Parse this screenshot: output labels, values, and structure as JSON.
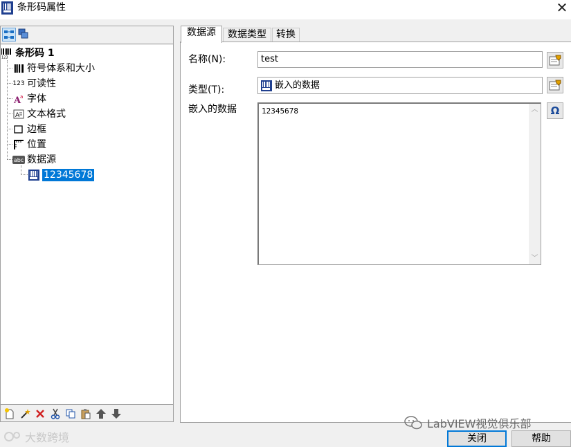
{
  "window": {
    "title": "条形码属性",
    "close_glyph": "✕"
  },
  "left_toolbar": {
    "icons": [
      "tree-view-icon",
      "layers-icon"
    ]
  },
  "tree": {
    "root": {
      "label": "条形码 1",
      "icon": "barcode-small-icon"
    },
    "items": [
      {
        "label": "符号体系和大小",
        "icon": "barcode-icon"
      },
      {
        "label": "可读性",
        "icon": "readable-123-icon",
        "icon_text": "123"
      },
      {
        "label": "字体",
        "icon": "font-icon",
        "icon_text": "A"
      },
      {
        "label": "文本格式",
        "icon": "text-format-icon"
      },
      {
        "label": "边框",
        "icon": "border-icon"
      },
      {
        "label": "位置",
        "icon": "position-icon"
      },
      {
        "label": "数据源",
        "icon": "data-source-icon",
        "icon_text": "abc"
      }
    ],
    "child": {
      "label": "12345678",
      "icon": "embedded-data-icon",
      "selected": true
    }
  },
  "bottom_toolbar": {
    "icons": [
      "new-item-icon",
      "magic-wand-icon",
      "delete-icon",
      "cut-icon",
      "copy-icon",
      "paste-icon",
      "move-up-icon",
      "move-down-icon"
    ]
  },
  "tabs": [
    {
      "label": "数据源",
      "active": true
    },
    {
      "label": "数据类型",
      "active": false
    },
    {
      "label": "转换",
      "active": false
    }
  ],
  "form": {
    "name_label": "名称(N):",
    "name_value": "test",
    "type_label": "类型(T):",
    "type_value": "嵌入的数据",
    "embedded_label": "嵌入的数据",
    "embedded_value": "12345678",
    "omega_glyph": "Ω"
  },
  "buttons": {
    "close": "关闭",
    "help": "帮助"
  },
  "watermarks": {
    "left": "大数跨境",
    "right": "LabVIEW视觉俱乐部"
  },
  "colors": {
    "selection": "#0078d7",
    "delete_red": "#d02020",
    "arrow_gray": "#555555"
  }
}
